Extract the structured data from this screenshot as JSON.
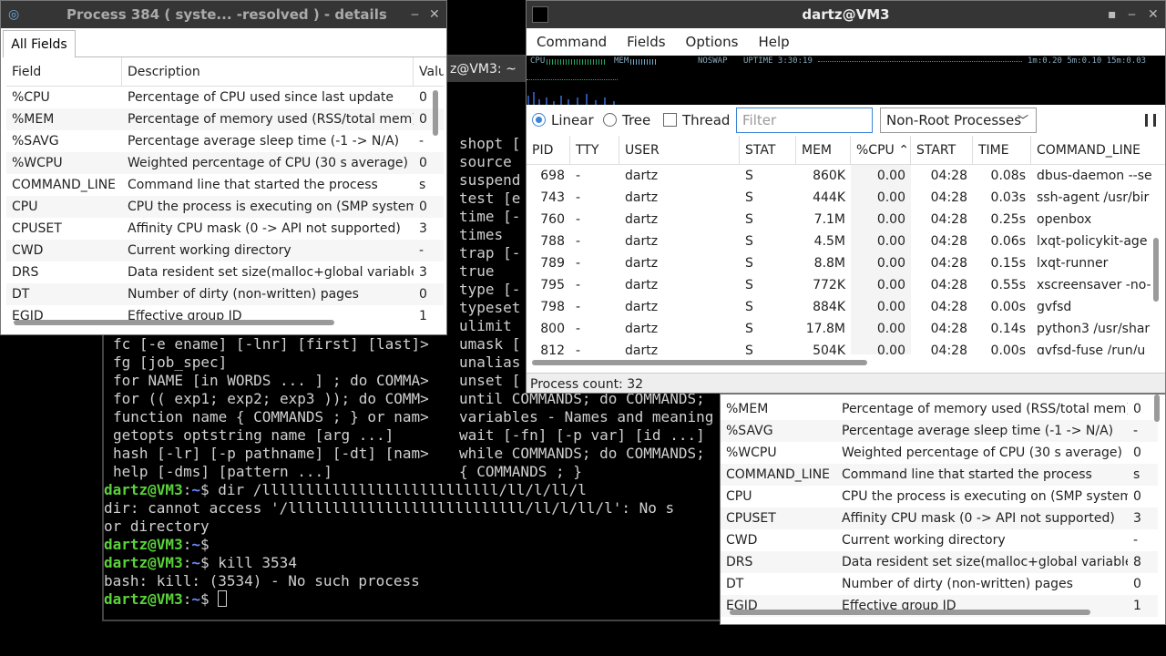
{
  "terminal": {
    "title_fragment": "z@VM3: ~",
    "lines": [
      "fc [-e ename] [-lnr] [first] [last]>",
      "fg [job_spec]",
      "for NAME [in WORDS ... ] ; do COMMA>",
      "for (( exp1; exp2; exp3 )); do COMM>",
      "function name { COMMANDS ; } or nam>",
      "getopts optstring name [arg ...]",
      "hash [-lr] [-p pathname] [-dt] [nam>",
      "help [-dms] [pattern ...]"
    ],
    "right_col": [
      "shopt [",
      "source",
      "suspend",
      "test [e",
      "time [-",
      "times",
      "trap [-",
      "true",
      "type [-",
      "typeset",
      "ulimit",
      "umask [",
      "unalias",
      "unset [",
      "until COMMANDS; do COMMANDS;",
      "variables - Names and meaning",
      "wait [-fn] [-p var] [id ...]",
      "while COMMANDS; do COMMANDS;",
      "{ COMMANDS ; }"
    ],
    "prompt_user": "dartz@VM3",
    "prompt_path": "~",
    "cmd1": "dir /lllllllllllllllllllllllllll/ll/l/ll/l",
    "err1": "dir: cannot access '/lllllllllllllllllllllllllll/ll/l/ll/l': No s",
    "err1b": "or directory",
    "cmd3": "kill 3534",
    "err3": "bash: kill: (3534) - No such process"
  },
  "details_window_1": {
    "title": "Process 384 ( syste...  -resolved ) - details",
    "tab": "All Fields",
    "headers": [
      "Field",
      "Description",
      "Valu"
    ],
    "rows": [
      [
        "%CPU",
        "Percentage of CPU used since last update",
        "0"
      ],
      [
        "%MEM",
        "Percentage of memory used (RSS/total mem)",
        "0"
      ],
      [
        "%SAVG",
        "Percentage average sleep time (-1 -> N/A)",
        "-"
      ],
      [
        "%WCPU",
        "Weighted percentage of CPU (30 s average)",
        "0"
      ],
      [
        "COMMAND_LINE",
        "Command line that started the process",
        "s"
      ],
      [
        "CPU",
        "CPU the process is executing on (SMP system)",
        "0"
      ],
      [
        "CPUSET",
        "Affinity CPU mask (0 -> API not supported)",
        "3"
      ],
      [
        "CWD",
        "Current working directory",
        "-"
      ],
      [
        "DRS",
        "Data resident set size(malloc+global variable)",
        "3"
      ],
      [
        "DT",
        "Number of dirty (non-written) pages",
        "0"
      ],
      [
        "EGID",
        "Effective group ID",
        "1"
      ]
    ]
  },
  "main_window": {
    "title": "dartz@VM3",
    "menu": [
      "Command",
      "Fields",
      "Options",
      "Help"
    ],
    "graph": {
      "cpu_label": "CPU",
      "mem_label": "MEM",
      "noswap_label": "NOSWAP",
      "uptime": "UPTIME 3:30:19",
      "load": "1m:0.20 5m:0.10 15m:0.03"
    },
    "view_modes": {
      "linear": "Linear",
      "tree": "Tree",
      "thread": "Thread",
      "selected": "Linear",
      "thread_checked": false
    },
    "filter_placeholder": "Filter",
    "process_filter": "Non-Root Processes",
    "columns": [
      "PID",
      "TTY",
      "USER",
      "STAT",
      "MEM",
      "%CPU",
      "START",
      "TIME",
      "COMMAND_LINE"
    ],
    "sort_column": "%CPU",
    "processes": [
      [
        "698",
        "-",
        "dartz",
        "S",
        "860K",
        "0.00",
        "04:28",
        "0.08s",
        "dbus-daemon --se"
      ],
      [
        "743",
        "-",
        "dartz",
        "S",
        "444K",
        "0.00",
        "04:28",
        "0.03s",
        "ssh-agent /usr/bir"
      ],
      [
        "760",
        "-",
        "dartz",
        "S",
        "7.1M",
        "0.00",
        "04:28",
        "0.25s",
        "openbox"
      ],
      [
        "788",
        "-",
        "dartz",
        "S",
        "4.5M",
        "0.00",
        "04:28",
        "0.06s",
        "lxqt-policykit-age"
      ],
      [
        "789",
        "-",
        "dartz",
        "S",
        "8.8M",
        "0.00",
        "04:28",
        "0.15s",
        "lxqt-runner"
      ],
      [
        "795",
        "-",
        "dartz",
        "S",
        "772K",
        "0.00",
        "04:28",
        "0.55s",
        "xscreensaver -no-"
      ],
      [
        "798",
        "-",
        "dartz",
        "S",
        "884K",
        "0.00",
        "04:28",
        "0.00s",
        "gvfsd"
      ],
      [
        "800",
        "-",
        "dartz",
        "S",
        "17.8M",
        "0.00",
        "04:28",
        "0.14s",
        "python3 /usr/shar"
      ],
      [
        "812",
        "-",
        "dartz",
        "S",
        "504K",
        "0.00",
        "04:28",
        "0.00s",
        "gvfsd-fuse /run/u"
      ]
    ],
    "status": "Process count: 32"
  },
  "details_window_2": {
    "rows": [
      [
        "%MEM",
        "Percentage of memory used (RSS/total mem)",
        "0"
      ],
      [
        "%SAVG",
        "Percentage average sleep time (-1 -> N/A)",
        "-"
      ],
      [
        "%WCPU",
        "Weighted percentage of CPU (30 s average)",
        "0"
      ],
      [
        "COMMAND_LINE",
        "Command line that started the process",
        "s"
      ],
      [
        "CPU",
        "CPU the process is executing on (SMP system)",
        "0"
      ],
      [
        "CPUSET",
        "Affinity CPU mask (0 -> API not supported)",
        "3"
      ],
      [
        "CWD",
        "Current working directory",
        "-"
      ],
      [
        "DRS",
        "Data resident set size(malloc+global variable)",
        "8"
      ],
      [
        "DT",
        "Number of dirty (non-written) pages",
        "0"
      ],
      [
        "EGID",
        "Effective group ID",
        "1"
      ]
    ]
  }
}
